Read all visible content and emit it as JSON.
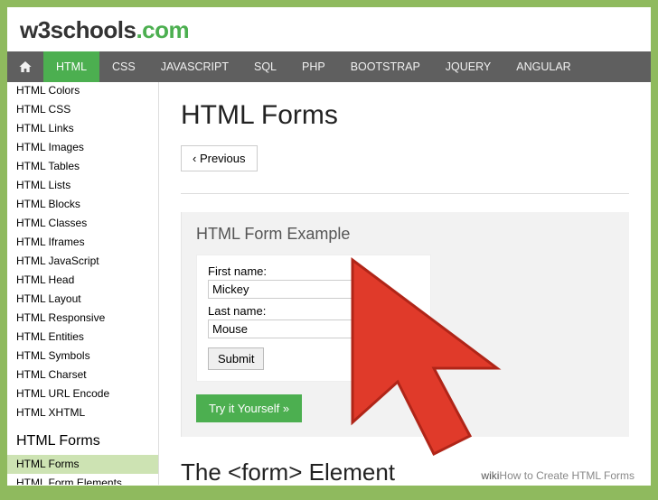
{
  "logo": {
    "part1": "w3schools",
    "part2": ".com"
  },
  "topnav": {
    "items": [
      "HTML",
      "CSS",
      "JAVASCRIPT",
      "SQL",
      "PHP",
      "BOOTSTRAP",
      "JQUERY",
      "ANGULAR"
    ],
    "active_index": 0
  },
  "sidebar": {
    "items_top": [
      "HTML Colors",
      "HTML CSS",
      "HTML Links",
      "HTML Images",
      "HTML Tables",
      "HTML Lists",
      "HTML Blocks",
      "HTML Classes",
      "HTML Iframes",
      "HTML JavaScript",
      "HTML Head",
      "HTML Layout",
      "HTML Responsive",
      "HTML Entities",
      "HTML Symbols",
      "HTML Charset",
      "HTML URL Encode",
      "HTML XHTML"
    ],
    "heading": "HTML Forms",
    "items_bottom": [
      "HTML Forms",
      "HTML Form Elements"
    ],
    "active": "HTML Forms"
  },
  "page": {
    "title": "HTML Forms",
    "prev_label": "‹ Previous",
    "example_title": "HTML Form Example",
    "form": {
      "first_label": "First name:",
      "first_value": "Mickey",
      "last_label": "Last name:",
      "last_value": "Mouse",
      "submit": "Submit"
    },
    "try_label": "Try it Yourself »",
    "section2": "The <form> Element"
  },
  "watermark": {
    "prefix": "wiki",
    "text": "How to Create HTML Forms"
  }
}
